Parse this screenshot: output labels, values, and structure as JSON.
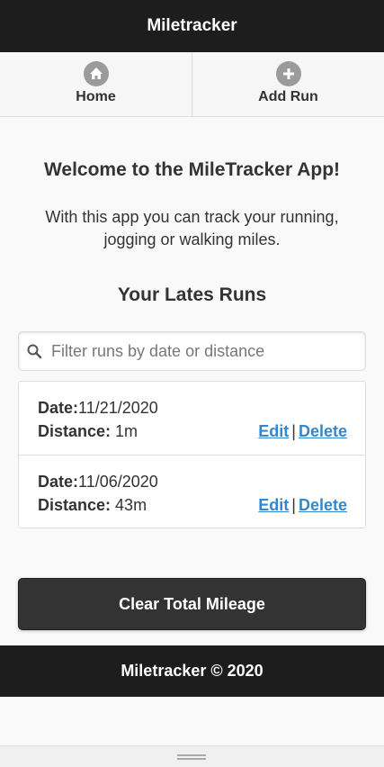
{
  "header": {
    "title": "Miletracker"
  },
  "nav": [
    {
      "label": "Home",
      "icon": "home-icon"
    },
    {
      "label": "Add Run",
      "icon": "plus-icon"
    }
  ],
  "main": {
    "welcome_title": "Welcome to the MileTracker App!",
    "welcome_text": "With this app you can track your running, jogging or walking miles.",
    "runs_title": "Your Lates Runs"
  },
  "search": {
    "placeholder": "Filter runs by date or distance",
    "value": ""
  },
  "runs": [
    {
      "date_label": "Date:",
      "date": "11/21/2020",
      "distance_label": "Distance:",
      "distance": "1m",
      "edit": "Edit",
      "separator": "|",
      "delete": "Delete"
    },
    {
      "date_label": "Date:",
      "date": "11/06/2020",
      "distance_label": "Distance:",
      "distance": "43m",
      "edit": "Edit",
      "separator": "|",
      "delete": "Delete"
    }
  ],
  "actions": {
    "clear_label": "Clear Total Mileage"
  },
  "footer": {
    "text": "Miletracker © 2020"
  },
  "colors": {
    "header_bg": "#1d1d1d",
    "link": "#3388cc",
    "button_bg": "#333333",
    "icon_gray": "#9b9b9b"
  }
}
